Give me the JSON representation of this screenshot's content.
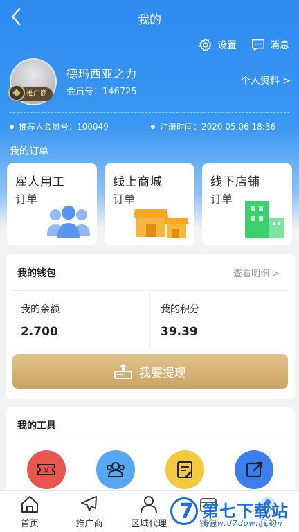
{
  "header": {
    "title": "我的"
  },
  "actions": {
    "settings": "设置",
    "messages": "消息"
  },
  "user": {
    "name": "德玛西亚之力",
    "member_label": "会员号：",
    "member_id": "146725",
    "badge": "推广商",
    "profile_link": "个人资料 >"
  },
  "meta": {
    "referrer": "推荐人会员号：100049",
    "registered": "注册时间：2020.05.06 18:36"
  },
  "orders": {
    "section_title": "我的订单",
    "items": [
      {
        "title": "雇人用工",
        "subtitle": "订单"
      },
      {
        "title": "线上商城",
        "subtitle": "订单"
      },
      {
        "title": "线下店铺",
        "subtitle": "订单"
      }
    ]
  },
  "wallet": {
    "title": "我的钱包",
    "details_link": "查看明细 >",
    "balance_label": "我的余额",
    "balance_value": "2.700",
    "points_label": "我的积分",
    "points_value": "39.39",
    "withdraw_label": "我要提现"
  },
  "tools": {
    "title": "我的工具",
    "icons": [
      "ticket-icon",
      "group-icon",
      "note-icon",
      "share-icon"
    ]
  },
  "tabbar": {
    "items": [
      "首页",
      "推广商",
      "区域代理",
      "钱包",
      "我的"
    ]
  },
  "watermark": {
    "text": "第七下载站",
    "url": "www.d7down.com"
  },
  "colors": {
    "primary": "#2e8bf0",
    "gold": "#d6b36f",
    "watermark": "#1d6fd8"
  }
}
